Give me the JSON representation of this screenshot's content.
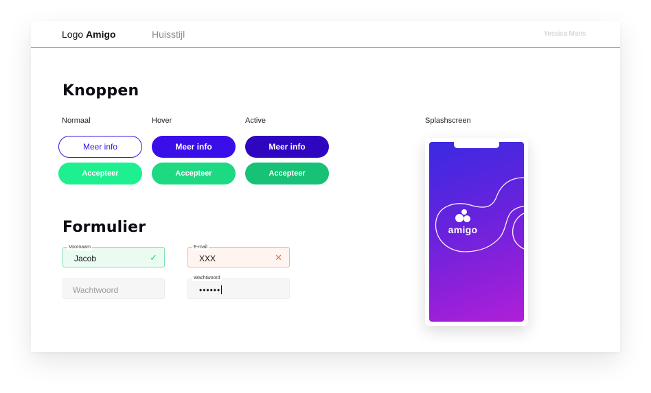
{
  "header": {
    "logo_prefix": "Logo",
    "logo_brand": "Amigo",
    "nav_link": "Huisstijl",
    "user_name": "Yessica Mans"
  },
  "buttons_section": {
    "title": "Knoppen",
    "columns": [
      "Normaal",
      "Hover",
      "Active"
    ],
    "primary_label": "Meer info",
    "secondary_label": "Accepteer"
  },
  "form_section": {
    "title": "Formulier",
    "voornaam": {
      "legend": "Voornaam",
      "value": "Jacob",
      "status_icon": "✓"
    },
    "email": {
      "legend": "E-mail",
      "value": "XXX",
      "status_icon": "✕"
    },
    "wachtwoord_empty": {
      "placeholder": "Wachtwoord"
    },
    "wachtwoord_filled": {
      "legend": "Wachtwoord",
      "value": "••••••"
    }
  },
  "splash": {
    "label": "Splashscreen",
    "brand": "amigo"
  },
  "colors": {
    "primary": "#3a10e0",
    "primary_hover": "#3a0ee8",
    "primary_active": "#2e06bf",
    "green": "#1ff08f",
    "green_hover": "#1cd982",
    "green_active": "#17c175",
    "valid": "#2ecc71",
    "error": "#f06a4a"
  }
}
